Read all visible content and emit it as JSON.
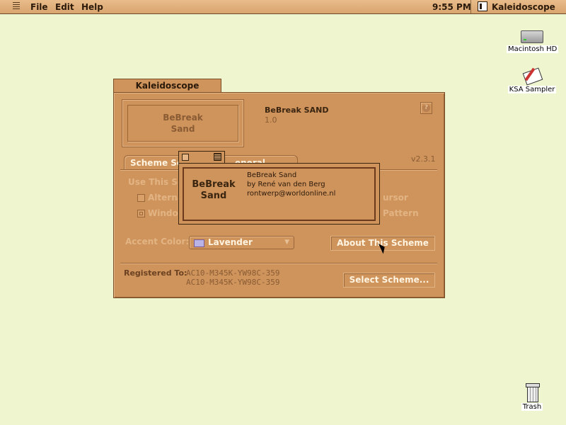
{
  "menubar": {
    "items": [
      "File",
      "Edit",
      "Help"
    ],
    "clock": "9:55 PM",
    "app_name": "Kaleidoscope"
  },
  "desktop": {
    "icons": [
      {
        "label": "Macintosh HD",
        "icon": "hard-drive-icon"
      },
      {
        "label": "KSA Sampler",
        "icon": "sampler-document-icon"
      },
      {
        "label": "Trash",
        "icon": "trash-icon"
      }
    ]
  },
  "window": {
    "title": "Kaleidoscope",
    "preview_line1": "BeBreak",
    "preview_line2": "Sand",
    "scheme_name": "BeBreak SAND",
    "scheme_version": "1.0",
    "app_version": "v2.3.1",
    "tabs": [
      "Scheme Se",
      "eneral Options"
    ],
    "use_scheme_label": "Use This Sc",
    "option1": "Alterna",
    "option1_right": "ursor",
    "option2": "Window",
    "option2_right": "Pattern",
    "accent_label": "Accent Color:",
    "accent_value": "Lavender",
    "accent_swatch": "#b9b3e6",
    "about_button": "About This Scheme",
    "registered_label": "Registered To:",
    "registered_line1": "AC10-M345K-YW98C-359",
    "registered_line2": "AC10-M345K-YW98C-359",
    "select_button": "Select Scheme..."
  },
  "about_popup": {
    "name_line1": "BeBreak",
    "name_line2": "Sand",
    "info_title": "BeBreak Sand",
    "info_author": "by René van den Berg",
    "info_email": "rontwerp@worldonline.nl"
  },
  "colors": {
    "desktop": "#eef5cf",
    "window": "#cf935c",
    "menubar": "#d9a46e"
  }
}
